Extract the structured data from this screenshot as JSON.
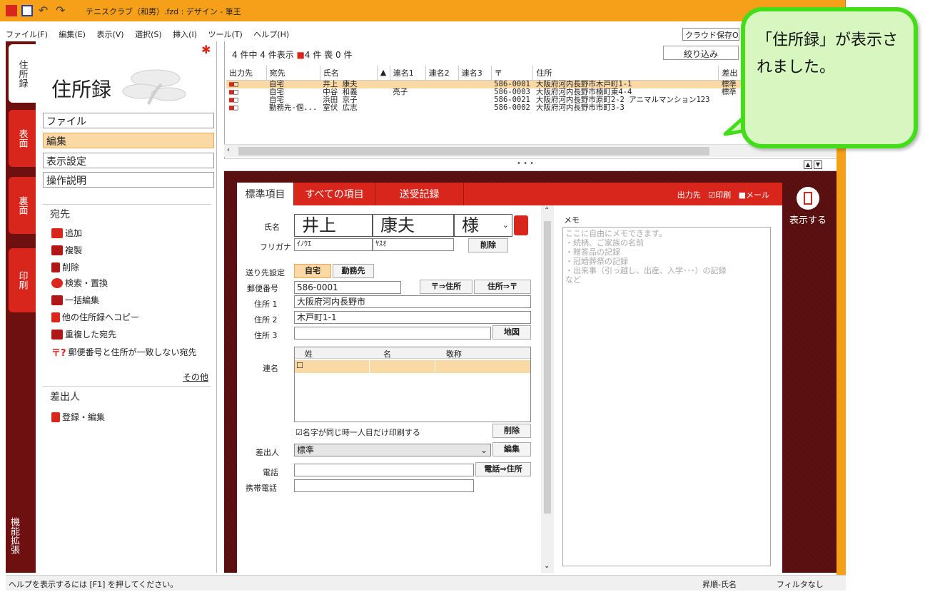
{
  "titlebar": {
    "title": "テニスクラブ（和男）.fzd : デザイン - 筆王"
  },
  "menubar": {
    "items": [
      "ファイル(F)",
      "編集(E)",
      "表示(V)",
      "選択(S)",
      "挿入(I)",
      "ツール(T)",
      "ヘルプ(H)"
    ],
    "cloud_save": "クラウド保存ON"
  },
  "vertical_tabs": [
    "住所録",
    "表面",
    "裏面",
    "印刷"
  ],
  "expand_tab": "機能拡張",
  "leftpanel": {
    "title": "住所録",
    "nav": [
      "ファイル",
      "編集",
      "表示設定",
      "操作説明"
    ],
    "recipients_head": "宛先",
    "recipient_actions": [
      "追加",
      "複製",
      "削除",
      "検索・置換",
      "一括編集",
      "他の住所録へコピー",
      "重複した宛先",
      "郵便番号と住所が一致しない宛先"
    ],
    "more": "その他",
    "sender_head": "差出人",
    "sender_action": "登録・編集"
  },
  "list": {
    "info": "4 件中 4 件表示 ",
    "print_count": "4 件",
    "mourning": "喪 0 件",
    "filter_button": "絞り込み",
    "columns": [
      "出力先",
      "宛先",
      "氏名",
      "▲",
      "連名1",
      "連名2",
      "連名3",
      "〒",
      "住所",
      "差出"
    ],
    "rows": [
      {
        "dest": "自宅",
        "name": "井上 康夫",
        "ren1": "",
        "zip": "586-0001",
        "addr": "大阪府河内長野市木戸町1-1",
        "sender": "標準"
      },
      {
        "dest": "自宅",
        "name": "中谷 和義",
        "ren1": "亮子",
        "zip": "586-0003",
        "addr": "大阪府河内長野市楠町東4-4",
        "sender": "標準"
      },
      {
        "dest": "自宅",
        "name": "浜田 京子",
        "ren1": "",
        "zip": "586-0021",
        "addr": "大阪府河内長野市原町2-2 アニマルマンション123",
        "sender": ""
      },
      {
        "dest": "勤務先-個...",
        "name": "室伏 広志",
        "ren1": "",
        "zip": "586-0002",
        "addr": "大阪府河内長野市市町3-3",
        "sender": ""
      }
    ]
  },
  "detail": {
    "tabs": [
      "標準項目",
      "すべての項目",
      "送受記録"
    ],
    "output_label": "出力先",
    "print_opt": "印刷",
    "mail_opt": "メール",
    "show_button": "表示する",
    "form": {
      "name_label": "氏名",
      "last_name": "井上",
      "first_name": "康夫",
      "honorific": "様",
      "furigana_label": "フリガナ",
      "furi_last": "ｲﾉｳｴ",
      "furi_first": "ﾔｽｵ",
      "delete": "削除",
      "dest_label": "送り先設定",
      "home": "自宅",
      "work": "勤務先",
      "zip_label": "郵便番号",
      "zip": "586-0001",
      "zip_to_addr": "〒⇒住所",
      "addr_to_zip": "住所⇒〒",
      "addr1_label": "住所 1",
      "addr1": "大阪府河内長野市",
      "addr2_label": "住所 2",
      "addr2": "木戸町1-1",
      "addr3_label": "住所 3",
      "addr3": "",
      "map": "地図",
      "renmei_label": "連名",
      "renmei_cols": [
        "姓",
        "名",
        "敬称"
      ],
      "same_last_name": "名字が同じ時一人目だけ印刷する",
      "renmei_delete": "削除",
      "sender_label": "差出人",
      "sender_value": "標準",
      "sender_edit": "編集",
      "phone_label": "電話",
      "phone": "",
      "phone_to_addr": "電話⇒住所",
      "mobile_label": "携帯電話",
      "mobile": ""
    },
    "memo_label": "メモ",
    "memo_placeholder": "ここに自由にメモできます。\n・続柄、ご家族の名前\n・贈答品の記録\n・冠婚葬祭の記録\n・出来事（引っ越し、出産、入学･･･）の記録\nなど"
  },
  "statusbar": {
    "help": "ヘルプを表示するには [F1] を押してください。",
    "sort": "昇順-氏名",
    "filter": "フィルタなし"
  },
  "callout": {
    "text": "「住所録」が表示されました。"
  },
  "colors": {
    "accent": "#d9261c",
    "titlebar": "#f6a01a",
    "selection": "#fbd9a5",
    "callout_border": "#44dd1a"
  }
}
